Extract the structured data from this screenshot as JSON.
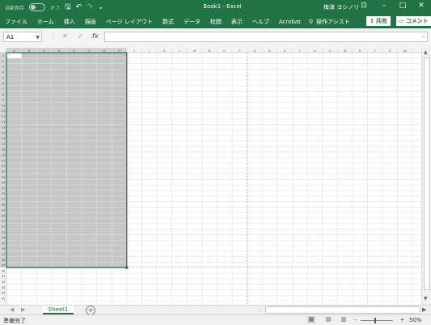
{
  "titlebar": {
    "autosave_label": "自動保存",
    "autosave_state": "オフ",
    "title": "Book1 - Excel",
    "user": "梅津 ヨシノリ",
    "icons": [
      "save-icon",
      "undo-icon",
      "redo-icon",
      "customize-icon"
    ]
  },
  "ribbon": {
    "tabs": [
      "ファイル",
      "ホーム",
      "挿入",
      "描画",
      "ページ レイアウト",
      "数式",
      "データ",
      "校閲",
      "表示",
      "ヘルプ",
      "Acrobat"
    ],
    "tell_me": "操作アシスト",
    "share": "共有",
    "comments": "コメント"
  },
  "formula_bar": {
    "name_box": "A1",
    "fx": "fx",
    "formula": ""
  },
  "grid": {
    "columns": [
      "A",
      "B",
      "C",
      "D",
      "E",
      "F",
      "G",
      "H",
      "I",
      "J",
      "K",
      "L",
      "M",
      "N",
      "O",
      "P",
      "Q",
      "R",
      "S",
      "T",
      "U",
      "V",
      "W",
      "X",
      "Y",
      "Z",
      "AA"
    ],
    "rows": [
      "1",
      "2",
      "3",
      "4",
      "5",
      "6",
      "7",
      "8",
      "9",
      "10",
      "11",
      "12",
      "13",
      "14",
      "15",
      "16",
      "17",
      "18",
      "19",
      "20",
      "21",
      "22",
      "23",
      "24",
      "25",
      "26",
      "27",
      "28",
      "29",
      "30",
      "31",
      "32",
      "33",
      "34",
      "35",
      "36",
      "37",
      "38",
      "39",
      "40",
      "41",
      "42",
      "43",
      "44",
      "45"
    ],
    "selection": "A1:H39",
    "selection_fill": "#c6c6c6",
    "selection_border": "#217346"
  },
  "sheets": {
    "tabs": [
      "Sheet1"
    ],
    "active": "Sheet1",
    "add": "+"
  },
  "status": {
    "ready": "準備完了",
    "zoom": "50%",
    "zoom_minus": "-",
    "zoom_plus": "+"
  },
  "colors": {
    "accent": "#217346"
  }
}
